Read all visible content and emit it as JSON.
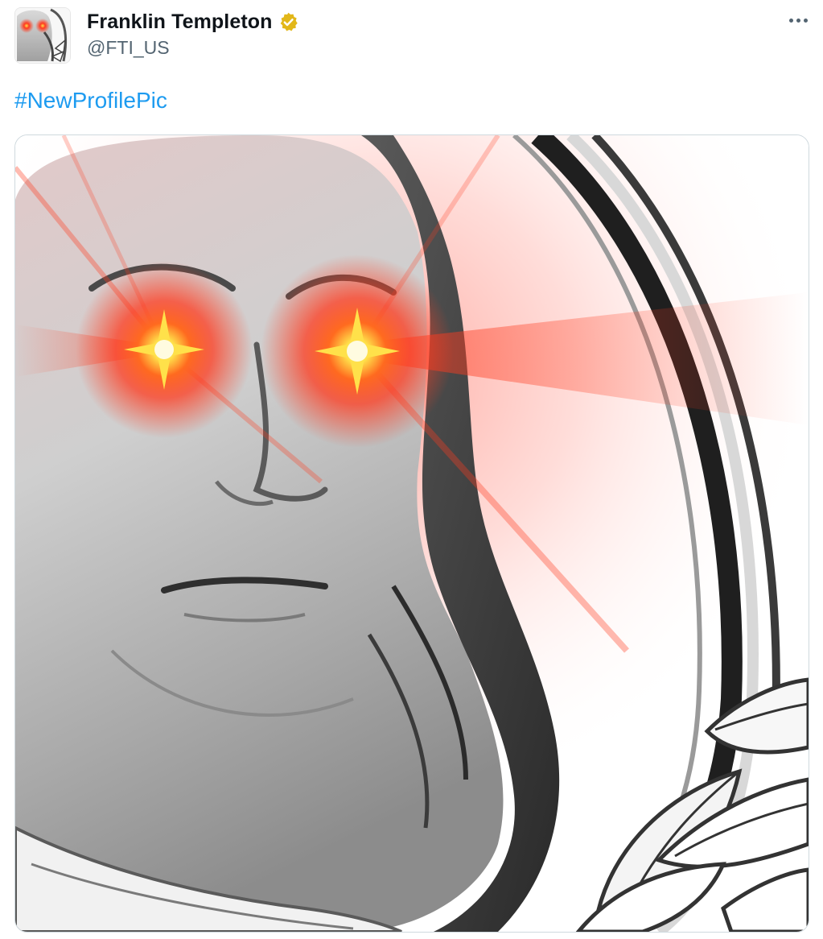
{
  "tweet": {
    "author": {
      "display_name": "Franklin Templeton",
      "handle": "@FTI_US",
      "verified_badge": "gold-check-icon",
      "avatar": "laser-eyes-portrait"
    },
    "more_menu": "more-options-icon",
    "text": {
      "hashtag": "#NewProfilePic"
    },
    "media": {
      "image": "portrait-with-laser-eyes-in-circular-frame-with-leaves"
    }
  },
  "colors": {
    "hashtag": "#1d9bf0",
    "verified_badge": "#e2b719",
    "laser": "#ff3b1f",
    "laser_core": "#ffe14a",
    "handle": "#536471"
  }
}
